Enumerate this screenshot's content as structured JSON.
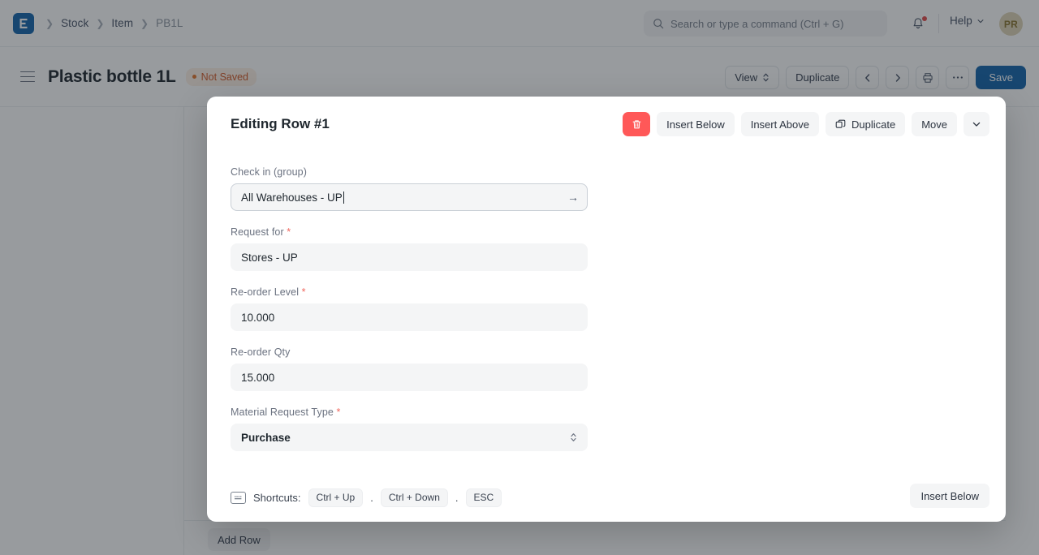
{
  "navbar": {
    "logo_icon": "erpnext-logo-icon",
    "breadcrumbs": [
      {
        "label": "Stock"
      },
      {
        "label": "Item"
      },
      {
        "label": "PB1L"
      }
    ],
    "search": {
      "placeholder": "Search or type a command (Ctrl + G)",
      "value": "",
      "icon": "search-icon"
    },
    "notifications_icon": "bell-icon",
    "has_notification_badge": true,
    "help_label": "Help",
    "help_chevron_icon": "chevron-down-icon",
    "avatar_initials": "PR"
  },
  "page_header": {
    "menu_icon": "hamburger-menu-icon",
    "title": "Plastic bottle 1L",
    "status_badge": "Not Saved",
    "toolbar": {
      "view_label": "View",
      "view_chevron_icon": "chevron-up-down-icon",
      "duplicate_label": "Duplicate",
      "prev_icon": "chevron-left-icon",
      "next_icon": "chevron-right-icon",
      "print_icon": "printer-icon",
      "more_icon": "ellipsis-icon",
      "save_label": "Save"
    }
  },
  "background": {
    "add_row_label": "Add Row"
  },
  "modal": {
    "title": "Editing Row #1",
    "row_actions": {
      "delete_icon": "trash-icon",
      "insert_below_label": "Insert Below",
      "insert_above_label": "Insert Above",
      "duplicate_label": "Duplicate",
      "duplicate_icon": "copy-icon",
      "move_label": "Move",
      "collapse_icon": "chevron-down-icon"
    },
    "fields": [
      {
        "label": "Check in (group)",
        "required": false,
        "value": "All Warehouses - UP",
        "type": "link",
        "focused": true,
        "trailing_icon": "arrow-right-icon"
      },
      {
        "label": "Request for",
        "required": true,
        "value": "Stores - UP",
        "type": "link",
        "focused": false,
        "trailing_icon": ""
      },
      {
        "label": "Re-order Level",
        "required": true,
        "value": "10.000",
        "type": "float",
        "focused": false,
        "trailing_icon": ""
      },
      {
        "label": "Re-order Qty",
        "required": false,
        "value": "15.000",
        "type": "float",
        "focused": false,
        "trailing_icon": ""
      },
      {
        "label": "Material Request Type",
        "required": true,
        "value": "Purchase",
        "type": "select",
        "focused": false,
        "trailing_icon": "chevron-up-down-icon"
      }
    ],
    "footer": {
      "keyboard_icon": "keyboard-icon",
      "shortcuts_label": "Shortcuts:",
      "keys": [
        "Ctrl + Up",
        "Ctrl + Down",
        "ESC"
      ],
      "separator": ".",
      "insert_below_label": "Insert Below"
    }
  },
  "colors": {
    "brand_blue": "#1464ab",
    "danger_red": "#ff5858",
    "warning_orange": "#d35c2a",
    "required_red": "#f0685f",
    "avatar_bg": "#ded3b6"
  }
}
